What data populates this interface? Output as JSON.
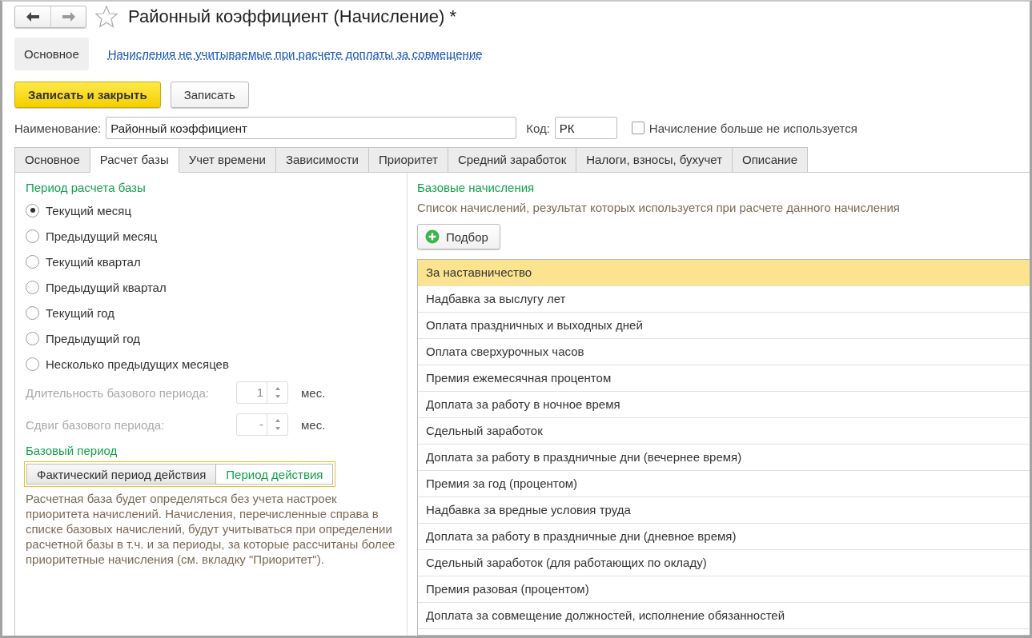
{
  "window": {
    "title": "Районный коэффициент (Начисление) *",
    "favorite": false
  },
  "sections": [
    {
      "label": "Основное",
      "selected": true
    },
    {
      "label": "Начисления не учитываемые при расчете доплаты за совмещение",
      "selected": false
    }
  ],
  "commands": [
    {
      "label": "Записать и закрыть",
      "kind": "primary"
    },
    {
      "label": "Записать",
      "kind": "default"
    }
  ],
  "name_field": {
    "label": "Наименование:",
    "value": "Районный коэффициент"
  },
  "code_field": {
    "label": "Код:",
    "value": "РК"
  },
  "unused_checkbox": {
    "label": "Начисление больше не используется",
    "checked": false
  },
  "tabs": [
    {
      "label": "Основное",
      "selected": false
    },
    {
      "label": "Расчет базы",
      "selected": true
    },
    {
      "label": "Учет времени",
      "selected": false
    },
    {
      "label": "Зависимости",
      "selected": false
    },
    {
      "label": "Приоритет",
      "selected": false
    },
    {
      "label": "Средний заработок",
      "selected": false
    },
    {
      "label": "Налоги, взносы, бухучет",
      "selected": false
    },
    {
      "label": "Описание",
      "selected": false
    }
  ],
  "base_period": {
    "title": "Период расчета базы",
    "options": [
      {
        "label": "Текущий месяц",
        "selected": true
      },
      {
        "label": "Предыдущий месяц",
        "selected": false
      },
      {
        "label": "Текущий квартал",
        "selected": false
      },
      {
        "label": "Предыдущий квартал",
        "selected": false
      },
      {
        "label": "Текущий год",
        "selected": false
      },
      {
        "label": "Предыдущий год",
        "selected": false
      },
      {
        "label": "Несколько предыдущих месяцев",
        "selected": false
      }
    ]
  },
  "spinners": [
    {
      "label": "Длительность базового периода:",
      "value": "1",
      "unit": "мес.",
      "disabled": true
    },
    {
      "label": "Сдвиг базового периода:",
      "value": "-",
      "unit": "мес.",
      "disabled": true
    }
  ],
  "period_kind": {
    "title": "Базовый период",
    "options": [
      {
        "label": "Фактический период действия",
        "selected": false
      },
      {
        "label": "Период действия",
        "selected": true
      }
    ]
  },
  "note": "Расчетная база будет определяться без учета настроек приоритета начислений. Начисления, перечисленные справа в списке базовых начислений, будут учитываться при определении расчетной базы в т.ч. и за периоды, за которые рассчитаны более приоритетные начисления (см. вкладку \"Приоритет\").",
  "base_accruals": {
    "title": "Базовые начисления",
    "hint": "Список начислений, результат которых используется при расчете данного начисления",
    "pick_button": "Подбор",
    "rows": [
      {
        "name": "За наставничество",
        "selected": true
      },
      {
        "name": "Надбавка за выслугу лет",
        "selected": false
      },
      {
        "name": "Оплата праздничных и выходных дней",
        "selected": false
      },
      {
        "name": "Оплата сверхурочных часов",
        "selected": false
      },
      {
        "name": "Премия ежемесячная процентом",
        "selected": false
      },
      {
        "name": "Доплата за работу в ночное время",
        "selected": false
      },
      {
        "name": "Сдельный заработок",
        "selected": false
      },
      {
        "name": "Доплата за работу в праздничные дни (вечернее время)",
        "selected": false
      },
      {
        "name": "Премия за год (процентом)",
        "selected": false
      },
      {
        "name": "Надбавка за вредные условия труда",
        "selected": false
      },
      {
        "name": "Доплата за работу в праздничные дни (дневное время)",
        "selected": false
      },
      {
        "name": "Сдельный заработок (для работающих по окладу)",
        "selected": false
      },
      {
        "name": "Премия разовая (процентом)",
        "selected": false
      },
      {
        "name": "Доплата за совмещение должностей, исполнение обязанностей",
        "selected": false
      }
    ]
  }
}
